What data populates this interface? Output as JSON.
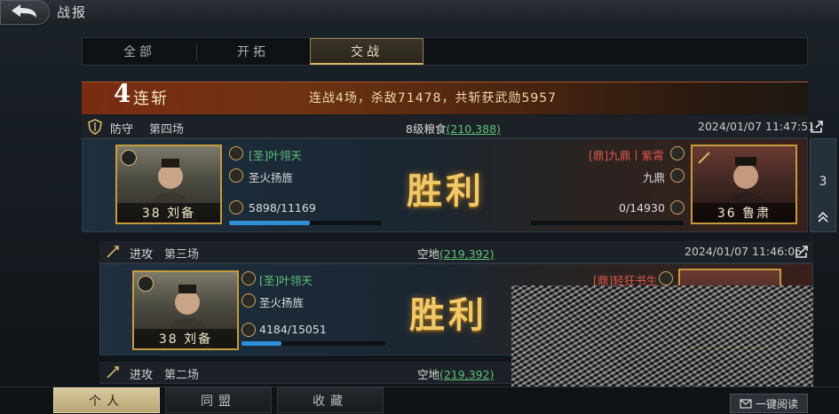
{
  "header": {
    "title": "战报"
  },
  "tabs": [
    {
      "label": "全部",
      "active": false
    },
    {
      "label": "开拓",
      "active": false
    },
    {
      "label": "交战",
      "active": true
    }
  ],
  "streak": {
    "count": "4",
    "label": "连斩",
    "summary": "连战4场，杀敌71478，共斩获武勋5957"
  },
  "reports": [
    {
      "type": "防守",
      "round": "第四场",
      "terrain_label": "8级粮食",
      "terrain_coords": "(210,388)",
      "timestamp": "2024/01/07 11:47:51",
      "result": "胜利",
      "left": {
        "player": "[圣]叶翎天",
        "army": "圣火扬旌",
        "general": "38 刘备",
        "troops": "5898/11169",
        "troops_fraction": 0.53
      },
      "right": {
        "player": "[鼎]九鼎丨紫霄",
        "army": "九鼎",
        "general": "36 鲁肃",
        "troops": "0/14930",
        "troops_fraction": 0.0
      },
      "side_count": "3"
    },
    {
      "type": "进攻",
      "round": "第三场",
      "terrain_label": "空地",
      "terrain_coords": "(219,392)",
      "timestamp": "2024/01/07 11:46:05",
      "result": "胜利",
      "left": {
        "player": "[圣]叶翎天",
        "army": "圣火扬旌",
        "general": "38 刘备",
        "troops": "4184/15051",
        "troops_fraction": 0.28
      },
      "right": {
        "player": "[鼎]轻狂书生"
      }
    },
    {
      "type": "进攻",
      "round": "第二场",
      "terrain_label": "空地",
      "terrain_coords": "(219,392)"
    }
  ],
  "bottom_nav": [
    {
      "label": "个人",
      "active": true
    },
    {
      "label": "同盟",
      "active": false
    },
    {
      "label": "收藏",
      "active": false
    }
  ],
  "read_all": "一键阅读",
  "colors": {
    "accent_gold": "#d8b46a",
    "ally_green": "#5fc27a",
    "enemy_red": "#e0564b",
    "victory_gold": "#f0c867"
  }
}
